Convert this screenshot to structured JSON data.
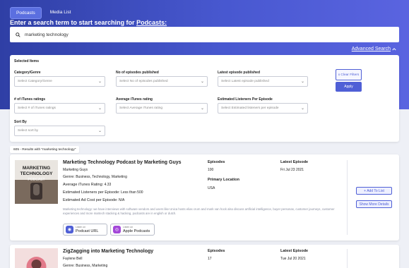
{
  "tabs": [
    {
      "label": "Podcasts"
    },
    {
      "label": "Media List"
    }
  ],
  "headline": {
    "prefix": "Enter a search term to start searching for ",
    "link": "Podcasts:"
  },
  "search": {
    "value": "marketing technology",
    "icon": "search-icon"
  },
  "advanced_search": {
    "label": "Advanced Search",
    "icon": "chevron-up-icon"
  },
  "filters": {
    "section_title": "Selected Items",
    "category": {
      "label": "Category/Genre",
      "placeholder": "Select Category/Genre"
    },
    "episodes": {
      "label": "No of episodes published",
      "placeholder": "Select No of episodes published"
    },
    "latest_episode": {
      "label": "Latest episode published",
      "placeholder": "Select Latest episode published"
    },
    "itunes_ratings": {
      "label": "# of iTunes ratings",
      "placeholder": "Select # of iTunes ratings"
    },
    "avg_rating": {
      "label": "Average iTunes rating",
      "placeholder": "Select Average iTunes rating"
    },
    "listeners": {
      "label": "Estimated Listeners Per Episode",
      "placeholder": "Select Estimated listeners per episode"
    },
    "sort": {
      "label": "Sort By",
      "placeholder": "Select sort by"
    },
    "clear_label": "x Clear Filters",
    "apply_label": "Apply"
  },
  "results_count": "605 - Results with \"marketing technology\"",
  "results": [
    {
      "title": "Marketing Technology Podcast by Marketing Guys",
      "author": "Marketing Guys",
      "genre_label": "Genre:",
      "genre": "Business, Technology, Marketing",
      "rating_label": "Average iTunes Rating:",
      "rating": "4.33",
      "listeners_label": "Estimated Listeners per Episode:",
      "listeners": "Less than 500",
      "adcost_label": "Estimated Ad Cost per Episode:",
      "adcost": "N/A",
      "episodes_label": "Episodes",
      "episodes": "100",
      "location_label": "Primary Location",
      "location": "USA",
      "latest_label": "Latest Episode",
      "latest": "Fri Jul 23 2021",
      "description": "Marketing technology: we have interviews with software vendors and users like Unica hosts elias crum and mark van hock also discuss artificial intelligence, buyer personas, customer journeys, customer experiences and more martech stacking & hacking, podcasts are in english or dutch.",
      "thumb_text": [
        "MARKETING",
        "TECHNOLOGY",
        "PODCAST"
      ],
      "podcast_url": {
        "small": "Listen on",
        "big": "Podcast URL"
      },
      "apple": {
        "small": "Listen on",
        "big": "Apple Podcasts"
      },
      "add_label": "+ Add To List",
      "more_label": "Show More Details"
    },
    {
      "title": "ZigZagging into Marketing Technology",
      "author": "Faylene Bell",
      "genre_label": "Genre:",
      "genre": "Business, Marketing",
      "episodes_label": "Episodes",
      "episodes": "17",
      "latest_label": "Latest Episode",
      "latest": "Tue Jul 20 2021"
    }
  ],
  "colors": {
    "accent": "#4f5fd6",
    "hero_start": "#2f3fa5",
    "hero_end": "#5a64e0"
  }
}
